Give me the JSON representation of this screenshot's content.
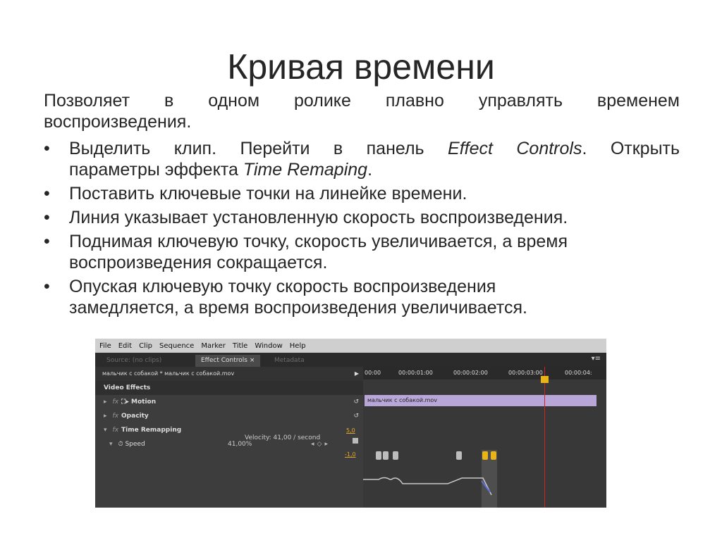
{
  "slide": {
    "title": "Кривая времени",
    "intro_line1": "Позволяет в одном ролике плавно управлять временем",
    "intro_line2": "воспроизведения.",
    "bullets": {
      "b1_line1_a": "Выделить клип. Перейти в панель ",
      "b1_line1_em": "Effect Controls",
      "b1_line1_b": ". Открыть",
      "b1_line2_a": "параметры эффекта ",
      "b1_line2_em": "Time Remaping",
      "b1_line2_b": ".",
      "b2": "Поставить ключевые точки на линейке времени.",
      "b3": "Линия указывает установленную скорость воспроизведения.",
      "b4_line1": "Поднимая ключевую точку, скорость увеличивается, а время",
      "b4_line2": "воспроизведения сокращается.",
      "b5_line1": "Опуская ключевую точку скорость воспроизведения",
      "b5_line2": "замедляется,  а время воспроизведения увеличивается."
    }
  },
  "app": {
    "menu": [
      "File",
      "Edit",
      "Clip",
      "Sequence",
      "Marker",
      "Title",
      "Window",
      "Help"
    ],
    "tabs": {
      "source": "Source: (no clips)",
      "effect_controls": "Effect Controls ×",
      "metadata": "Metadata",
      "panel_menu": "▾≡"
    },
    "clip_path": "мальчик с собакой * мальчик с собакой.mov",
    "video_effects": "Video Effects",
    "motion": "Motion",
    "opacity": "Opacity",
    "time_remapping": "Time Remapping",
    "speed_label": "Speed",
    "speed_value": "41,00%",
    "velocity": "Velocity: 41,00 / second",
    "y_max": "5,0",
    "y_min": "-1,0",
    "clip_name": "мальчик с собакой.mov",
    "timecodes": [
      "00:00",
      "00:00:01:00",
      "00:00:02:00",
      "00:00:03:00",
      "00:00:04:"
    ]
  }
}
